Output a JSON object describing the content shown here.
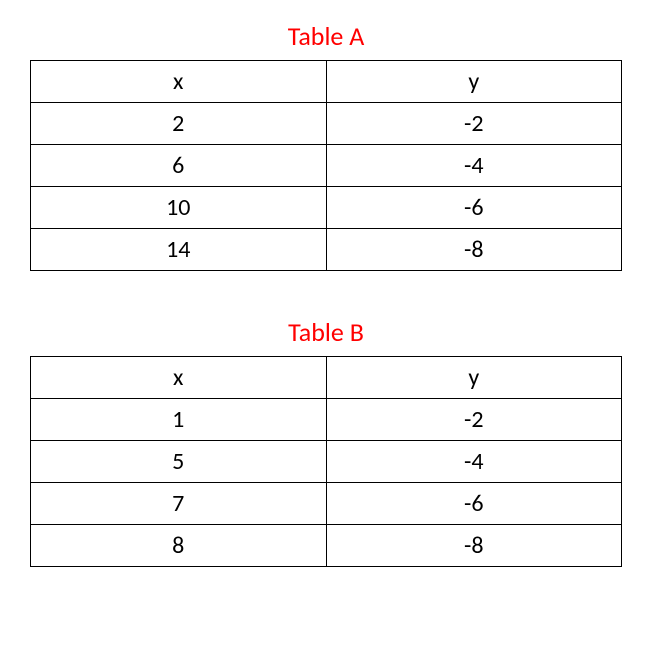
{
  "tableA": {
    "title": "Table A",
    "headers": {
      "col1": "x",
      "col2": "y"
    },
    "rows": [
      {
        "x": "2",
        "y": "-2"
      },
      {
        "x": "6",
        "y": "-4"
      },
      {
        "x": "10",
        "y": "-6"
      },
      {
        "x": "14",
        "y": "-8"
      }
    ]
  },
  "tableB": {
    "title": "Table B",
    "headers": {
      "col1": "x",
      "col2": "y"
    },
    "rows": [
      {
        "x": "1",
        "y": "-2"
      },
      {
        "x": "5",
        "y": "-4"
      },
      {
        "x": "7",
        "y": "-6"
      },
      {
        "x": "8",
        "y": "-8"
      }
    ]
  },
  "chart_data": [
    {
      "type": "table",
      "title": "Table A",
      "columns": [
        "x",
        "y"
      ],
      "data": [
        [
          2,
          -2
        ],
        [
          6,
          -4
        ],
        [
          10,
          -6
        ],
        [
          14,
          -8
        ]
      ]
    },
    {
      "type": "table",
      "title": "Table B",
      "columns": [
        "x",
        "y"
      ],
      "data": [
        [
          1,
          -2
        ],
        [
          5,
          -4
        ],
        [
          7,
          -6
        ],
        [
          8,
          -8
        ]
      ]
    }
  ]
}
